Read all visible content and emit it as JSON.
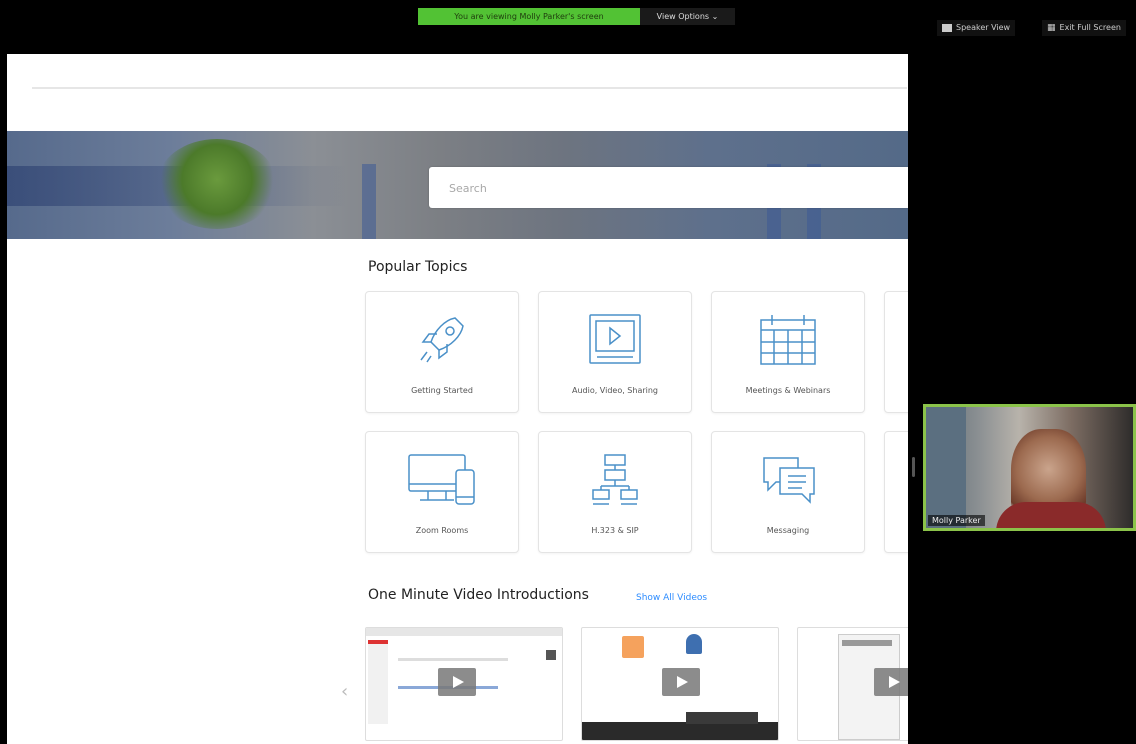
{
  "zoom": {
    "share_banner": "You are viewing Molly Parker's screen",
    "view_options": "View Options",
    "speaker_view": "Speaker View",
    "exit_full_screen": "Exit Full Screen",
    "accent_green": "#52c234"
  },
  "page": {
    "search_placeholder": "Search",
    "popular_topics_title": "Popular Topics",
    "topics": [
      {
        "label": "Getting Started",
        "icon": "rocket-icon"
      },
      {
        "label": "Audio, Video, Sharing",
        "icon": "video-player-icon"
      },
      {
        "label": "Meetings & Webinars",
        "icon": "calendar-icon"
      },
      {
        "label": "Zoom Rooms",
        "icon": "devices-icon"
      },
      {
        "label": "H.323 & SIP",
        "icon": "network-icon"
      },
      {
        "label": "Messaging",
        "icon": "chat-bubbles-icon"
      }
    ],
    "videos_title": "One Minute Video Introductions",
    "show_all_videos": "Show All Videos",
    "accent_blue": "#2d8cff"
  },
  "participant": {
    "name": "Molly Parker"
  }
}
